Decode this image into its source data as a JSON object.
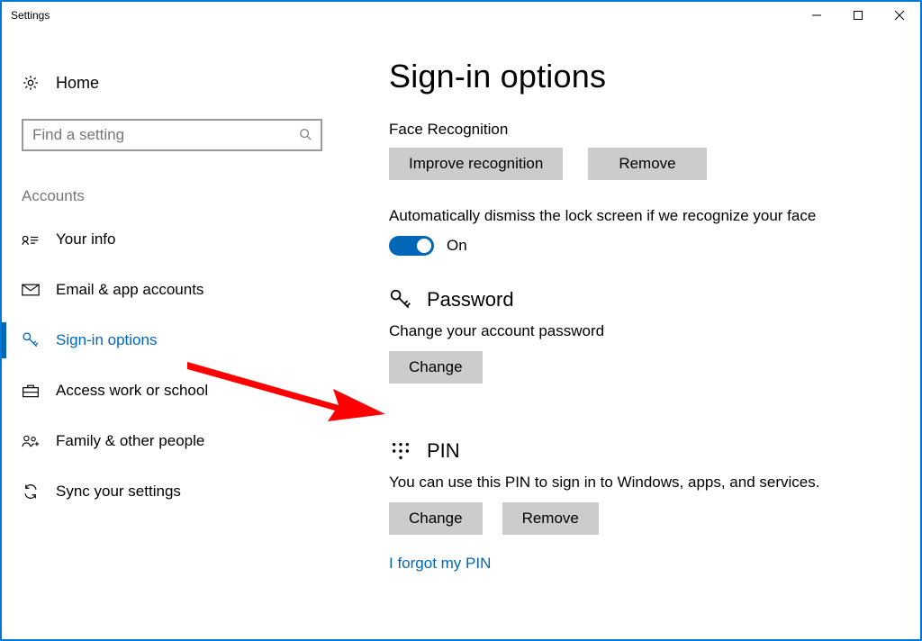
{
  "window": {
    "title": "Settings"
  },
  "nav": {
    "home": "Home",
    "search_placeholder": "Find a setting",
    "section": "Accounts",
    "items": [
      {
        "id": "your-info",
        "label": "Your info"
      },
      {
        "id": "email",
        "label": "Email & app accounts"
      },
      {
        "id": "sign-in",
        "label": "Sign-in options"
      },
      {
        "id": "work-school",
        "label": "Access work or school"
      },
      {
        "id": "family",
        "label": "Family & other people"
      },
      {
        "id": "sync",
        "label": "Sync your settings"
      }
    ]
  },
  "page": {
    "title": "Sign-in options",
    "face": {
      "heading": "Face Recognition",
      "improve": "Improve recognition",
      "remove": "Remove",
      "auto_dismiss": "Automatically dismiss the lock screen if we recognize your face",
      "toggle_state": "On"
    },
    "password": {
      "heading": "Password",
      "desc": "Change your account password",
      "change": "Change"
    },
    "pin": {
      "heading": "PIN",
      "desc": "You can use this PIN to sign in to Windows, apps, and services.",
      "change": "Change",
      "remove": "Remove",
      "forgot": "I forgot my PIN"
    }
  },
  "colors": {
    "accent": "#0067b8",
    "arrow": "#ff0000"
  }
}
